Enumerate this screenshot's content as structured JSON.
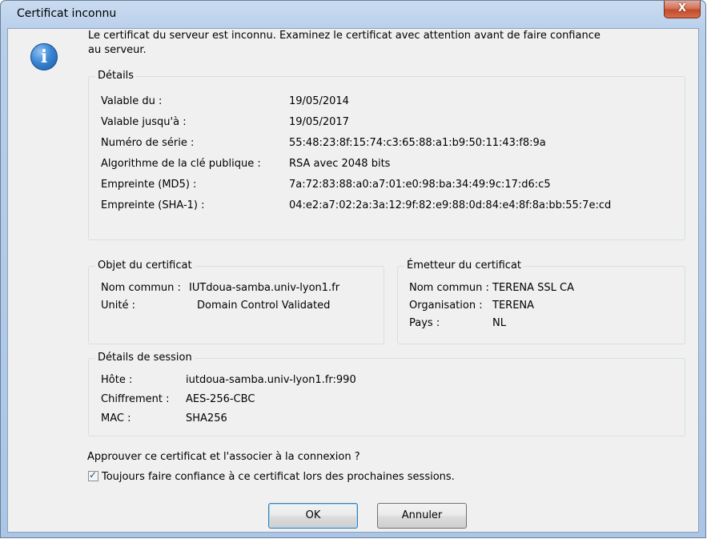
{
  "window": {
    "title": "Certificat inconnu",
    "close_label": "X"
  },
  "icon": {
    "name": "info-icon",
    "glyph": "i"
  },
  "message": "Le certificat du serveur est inconnu. Examinez le certificat avec attention avant de faire confiance au serveur.",
  "details": {
    "title": "Détails",
    "rows": [
      {
        "label": "Valable du :",
        "value": "19/05/2014"
      },
      {
        "label": "Valable jusqu'à :",
        "value": "19/05/2017"
      },
      {
        "label": "Numéro de série :",
        "value": "55:48:23:8f:15:74:c3:65:88:a1:b9:50:11:43:f8:9a"
      },
      {
        "label": "Algorithme de la clé publique :",
        "value": "RSA avec 2048 bits"
      },
      {
        "label": "Empreinte (MD5) :",
        "value": "7a:72:83:88:a0:a7:01:e0:98:ba:34:49:9c:17:d6:c5"
      },
      {
        "label": "Empreinte (SHA-1) :",
        "value": "04:e2:a7:02:2a:3a:12:9f:82:e9:88:0d:84:e4:8f:8a:bb:55:7e:cd"
      }
    ]
  },
  "subject": {
    "title": "Objet du certificat",
    "rows": [
      {
        "label": "Nom commun :",
        "value": "IUTdoua-samba.univ-lyon1.fr"
      },
      {
        "label": "Unité :",
        "value": "Domain Control Validated"
      }
    ]
  },
  "issuer": {
    "title": "Émetteur du certificat",
    "rows": [
      {
        "label": "Nom commun :",
        "value": "TERENA SSL CA"
      },
      {
        "label": "Organisation :",
        "value": "TERENA"
      },
      {
        "label": "Pays :",
        "value": "NL"
      }
    ]
  },
  "session": {
    "title": "Détails de session",
    "rows": [
      {
        "label": "Hôte :",
        "value": "iutdoua-samba.univ-lyon1.fr:990"
      },
      {
        "label": "Chiffrement :",
        "value": "AES-256-CBC"
      },
      {
        "label": "MAC :",
        "value": "SHA256"
      }
    ]
  },
  "approve_question": "Approuver ce certificat et l'associer à la connexion ?",
  "trust_checkbox": {
    "label": "Toujours faire confiance à ce certificat lors des prochaines sessions.",
    "checked": true
  },
  "buttons": {
    "ok": "OK",
    "cancel": "Annuler"
  }
}
